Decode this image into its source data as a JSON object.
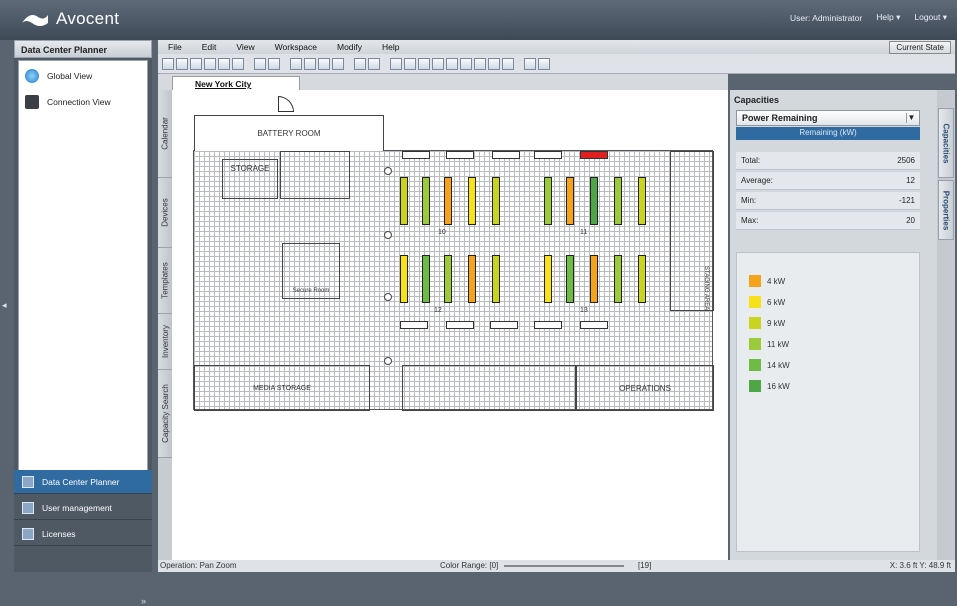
{
  "app": {
    "brand": "Avocent"
  },
  "user": {
    "label": "User: Administrator",
    "help": "Help ▾",
    "logout": "Logout ▾"
  },
  "left_panel": {
    "title": "Data Center Planner",
    "items": [
      {
        "label": "Global View",
        "icon": "globe-icon"
      },
      {
        "label": "Connection View",
        "icon": "network-icon"
      }
    ]
  },
  "nav": {
    "items": [
      {
        "label": "Data Center Planner"
      },
      {
        "label": "User management"
      },
      {
        "label": "Licenses"
      }
    ],
    "more": "»"
  },
  "menu": {
    "items": [
      "File",
      "Edit",
      "View",
      "Workspace",
      "Modify",
      "Help"
    ],
    "current_state": "Current State"
  },
  "doc": {
    "tab": "New York City"
  },
  "vtabs": [
    "Calendar",
    "Devices",
    "Templates",
    "Inventory",
    "Capacity Search"
  ],
  "floor": {
    "rooms": {
      "battery": "BATTERY ROOM",
      "storage": "STORAGE",
      "media": "MEDIA STORAGE",
      "operations": "OPERATIONS",
      "secure": "Secure Room",
      "staging": "STAGING AREA"
    },
    "row_numbers": [
      "10",
      "11",
      "12",
      "13"
    ]
  },
  "capacities": {
    "title": "Capacities",
    "selected": "Power Remaining",
    "header": "Remaining (kW)",
    "stats": [
      {
        "label": "Total:",
        "value": "2506"
      },
      {
        "label": "Average:",
        "value": "12"
      },
      {
        "label": "Min:",
        "value": "-121"
      },
      {
        "label": "Max:",
        "value": "20"
      }
    ],
    "legend": [
      {
        "label": "4 kW",
        "color": "#f4a31b"
      },
      {
        "label": "6 kW",
        "color": "#f7e21a"
      },
      {
        "label": "9 kW",
        "color": "#c8d41f"
      },
      {
        "label": "11 kW",
        "color": "#9bcb3b"
      },
      {
        "label": "14 kW",
        "color": "#6ebb46"
      },
      {
        "label": "16 kW",
        "color": "#4fa647"
      }
    ]
  },
  "right_tabs": [
    "Capacities",
    "Properties"
  ],
  "status": {
    "operation": "Operation:  Pan Zoom",
    "color_range": "Color Range:   [0]",
    "color_range_max": "[19]",
    "coords": "X: 3.6 ft Y: 48.9 ft"
  }
}
